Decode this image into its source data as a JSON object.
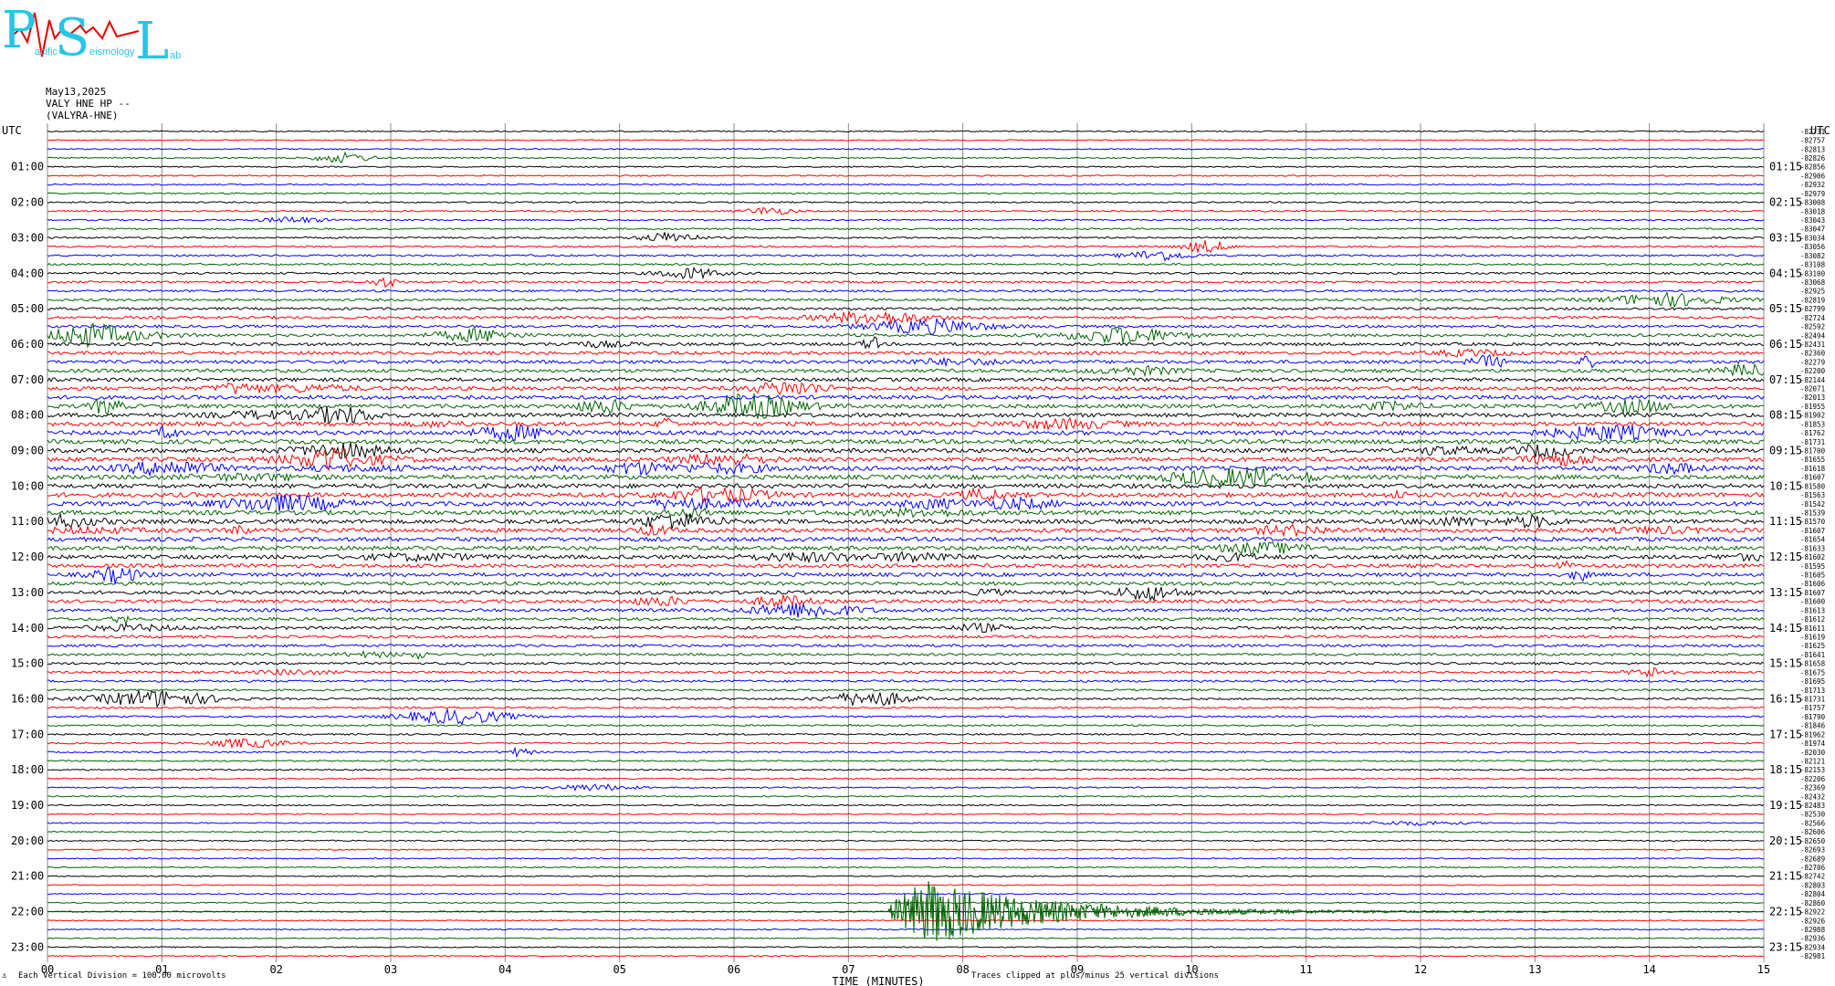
{
  "logo": {
    "letters": [
      "P",
      "S",
      "L"
    ],
    "words": [
      "acific",
      "eismology",
      "ab"
    ]
  },
  "header": {
    "date": "May13,2025",
    "station": "VALY HNE HP --",
    "site": "(VALYRA-HNE)"
  },
  "footer": {
    "scale_note": "Each Vertical Division =  100.00 microvolts",
    "clip_note": "Traces clipped at plus/minus 25 vertical divisions",
    "corner": "♙"
  },
  "chart_data": {
    "type": "line",
    "title": "",
    "xlabel": "TIME (MINUTES)",
    "left_axis_title": "UTC",
    "right_axis_title": "UTC",
    "x_ticks": [
      "00",
      "01",
      "02",
      "03",
      "04",
      "05",
      "06",
      "07",
      "08",
      "09",
      "10",
      "11",
      "12",
      "13",
      "14",
      "15"
    ],
    "left_hour_labels": [
      "01:00",
      "02:00",
      "03:00",
      "04:00",
      "05:00",
      "06:00",
      "07:00",
      "08:00",
      "09:00",
      "10:00",
      "11:00",
      "12:00",
      "13:00",
      "14:00",
      "15:00",
      "16:00",
      "17:00",
      "18:00",
      "19:00",
      "20:00",
      "21:00",
      "22:00",
      "23:00"
    ],
    "right_hour_labels": [
      "01:15",
      "02:15",
      "03:15",
      "04:15",
      "05:15",
      "06:15",
      "07:15",
      "08:15",
      "09:15",
      "10:15",
      "11:15",
      "12:15",
      "13:15",
      "14:15",
      "15:15",
      "16:15",
      "17:15",
      "18:15",
      "19:15",
      "20:15",
      "21:15",
      "22:15",
      "23:15"
    ],
    "trace_counts": [
      "-82731",
      "-82757",
      "-82813",
      "-82826",
      "-82856",
      "-82906",
      "-82932",
      "-82979",
      "-83008",
      "-83018",
      "-83043",
      "-83047",
      "-83034",
      "-83056",
      "-83082",
      "-83108",
      "-83100",
      "-83068",
      "-82925",
      "-82819",
      "-82799",
      "-82724",
      "-82592",
      "-82494",
      "-82431",
      "-82360",
      "-82279",
      "-82200",
      "-82144",
      "-82071",
      "-82013",
      "-81955",
      "-81902",
      "-81853",
      "-81762",
      "-81731",
      "-81700",
      "-81655",
      "-81618",
      "-81607",
      "-81580",
      "-81563",
      "-81542",
      "-81539",
      "-81570",
      "-81607",
      "-81654",
      "-81633",
      "-81602",
      "-81595",
      "-81605",
      "-81606",
      "-81607",
      "-81600",
      "-81613",
      "-81612",
      "-81611",
      "-81619",
      "-81625",
      "-81641",
      "-81658",
      "-81675",
      "-81695",
      "-81713",
      "-81731",
      "-81757",
      "-81790",
      "-81846",
      "-81962",
      "-81974",
      "-82030",
      "-82121",
      "-82153",
      "-82206",
      "-82369",
      "-82432",
      "-82483",
      "-82530",
      "-82566",
      "-82606",
      "-82650",
      "-82693",
      "-82689",
      "-82706",
      "-82742",
      "-82803",
      "-82804",
      "-82860",
      "-82922",
      "-82926",
      "-82988",
      "-82936",
      "-82934",
      "-82981"
    ],
    "trace_colors": [
      "#000000",
      "#ff0000",
      "#0000ff",
      "#006400"
    ],
    "traces_per_hour": 4,
    "minutes_per_trace": 15,
    "start_hour_utc": 0,
    "duration_hours": 24,
    "grid": true
  }
}
